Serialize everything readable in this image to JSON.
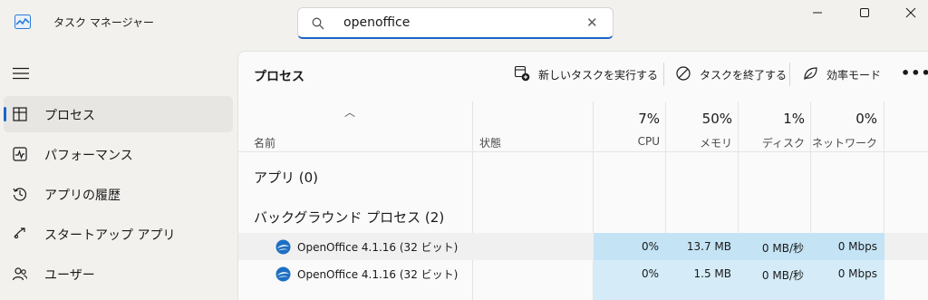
{
  "window": {
    "title": "タスク マネージャー"
  },
  "search": {
    "value": "openoffice"
  },
  "sidebar": {
    "items": [
      {
        "label": "プロセス",
        "icon": "processes-icon",
        "active": true
      },
      {
        "label": "パフォーマンス",
        "icon": "performance-icon"
      },
      {
        "label": "アプリの履歴",
        "icon": "history-icon"
      },
      {
        "label": "スタートアップ アプリ",
        "icon": "startup-icon"
      },
      {
        "label": "ユーザー",
        "icon": "users-icon"
      }
    ]
  },
  "main": {
    "title": "プロセス",
    "toolbar": {
      "new_task": "新しいタスクを実行する",
      "end_task": "タスクを終了する",
      "efficiency": "効率モード",
      "more": "•••"
    },
    "columns": {
      "name": "名前",
      "status": "状態",
      "cpu_pct": "7%",
      "cpu": "CPU",
      "mem_pct": "50%",
      "mem": "メモリ",
      "disk_pct": "1%",
      "disk": "ディスク",
      "net_pct": "0%",
      "net": "ネットワーク"
    },
    "groups": {
      "apps": "アプリ (0)",
      "background": "バックグラウンド プロセス (2)"
    },
    "rows": [
      {
        "name": "OpenOffice 4.1.16 (32 ビット)",
        "cpu": "0%",
        "memory": "13.7 MB",
        "disk": "0 MB/秒",
        "network": "0 Mbps"
      },
      {
        "name": "OpenOffice 4.1.16 (32 ビット)",
        "cpu": "0%",
        "memory": "1.5 MB",
        "disk": "0 MB/秒",
        "network": "0 Mbps"
      }
    ]
  },
  "colors": {
    "accent": "#1b66c9",
    "heat_light": "#d5ecf8",
    "heat_mid": "#c4e3f5"
  }
}
